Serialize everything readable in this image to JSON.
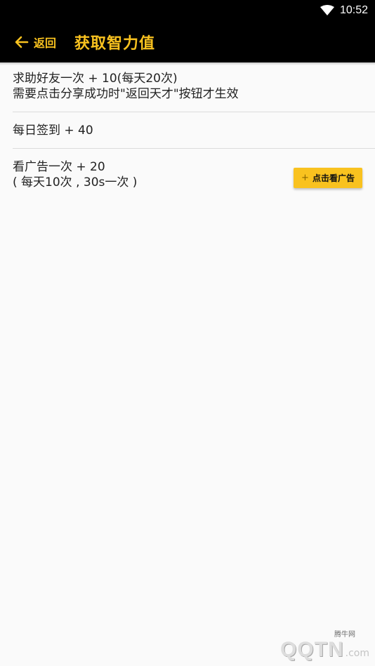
{
  "status_bar": {
    "time": "10:52",
    "wifi_icon": "wifi-icon"
  },
  "app_bar": {
    "back_label": "返回",
    "title": "获取智力值",
    "accent_color": "#f9c21f"
  },
  "items": [
    {
      "lines": [
        "求助好友一次 + 10(每天20次)",
        "需要点击分享成功时\"返回天才\"按钮才生效"
      ]
    },
    {
      "lines": [
        "每日签到 + 40"
      ]
    },
    {
      "lines": [
        "看广告一次 + 20",
        "( 每天10次 , 30s一次 )"
      ],
      "button_label": "点击看广告",
      "button_icon": "plus-icon"
    }
  ],
  "watermark": {
    "site": "腾牛网",
    "logo": "QQTN",
    "suffix": ".com"
  }
}
